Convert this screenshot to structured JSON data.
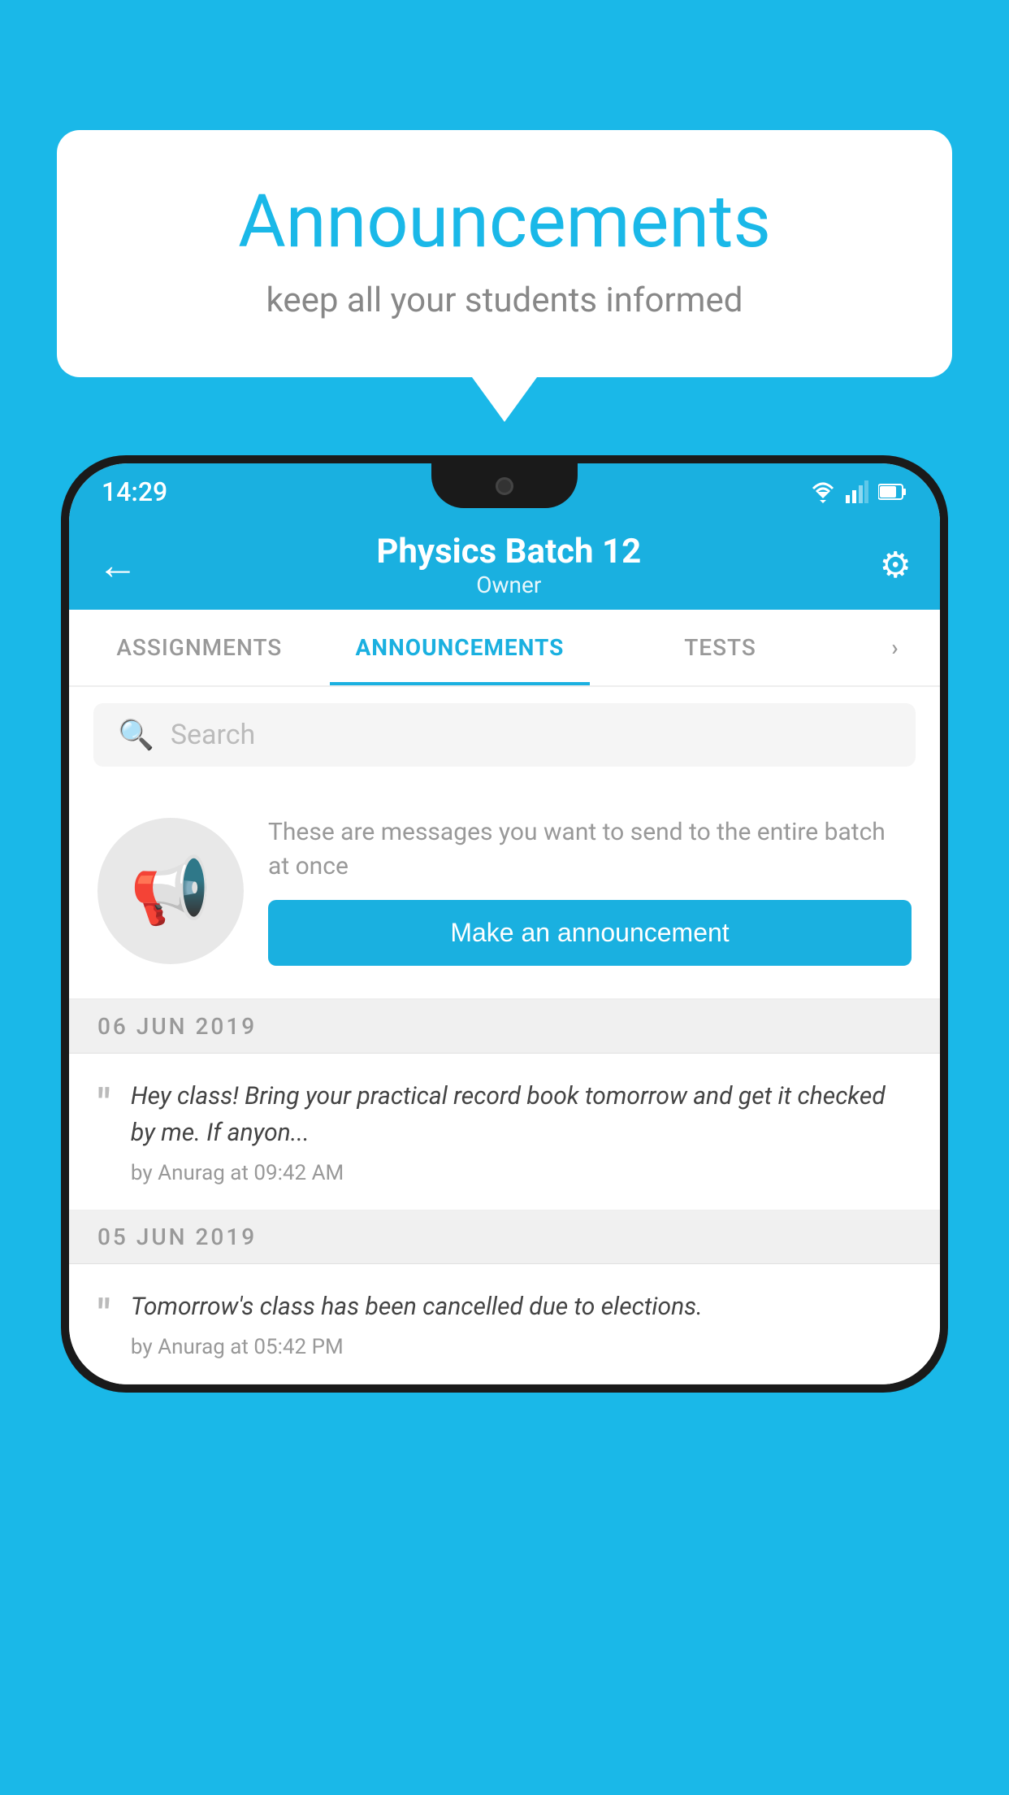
{
  "background_color": "#1ab8e8",
  "speech_bubble": {
    "title": "Announcements",
    "subtitle": "keep all your students informed"
  },
  "status_bar": {
    "time": "14:29"
  },
  "app_bar": {
    "title": "Physics Batch 12",
    "subtitle": "Owner",
    "back_label": "←",
    "gear_label": "⚙"
  },
  "tabs": [
    {
      "label": "ASSIGNMENTS",
      "active": false
    },
    {
      "label": "ANNOUNCEMENTS",
      "active": true
    },
    {
      "label": "TESTS",
      "active": false
    },
    {
      "label": "...",
      "active": false
    }
  ],
  "search": {
    "placeholder": "Search"
  },
  "announcement_promo": {
    "description": "These are messages you want to send to the entire batch at once",
    "button_label": "Make an announcement"
  },
  "announcements": [
    {
      "date": "06  JUN  2019",
      "text": "Hey class! Bring your practical record book tomorrow and get it checked by me. If anyon...",
      "meta": "by Anurag at 09:42 AM"
    },
    {
      "date": "05  JUN  2019",
      "text": "Tomorrow's class has been cancelled due to elections.",
      "meta": "by Anurag at 05:42 PM"
    }
  ]
}
